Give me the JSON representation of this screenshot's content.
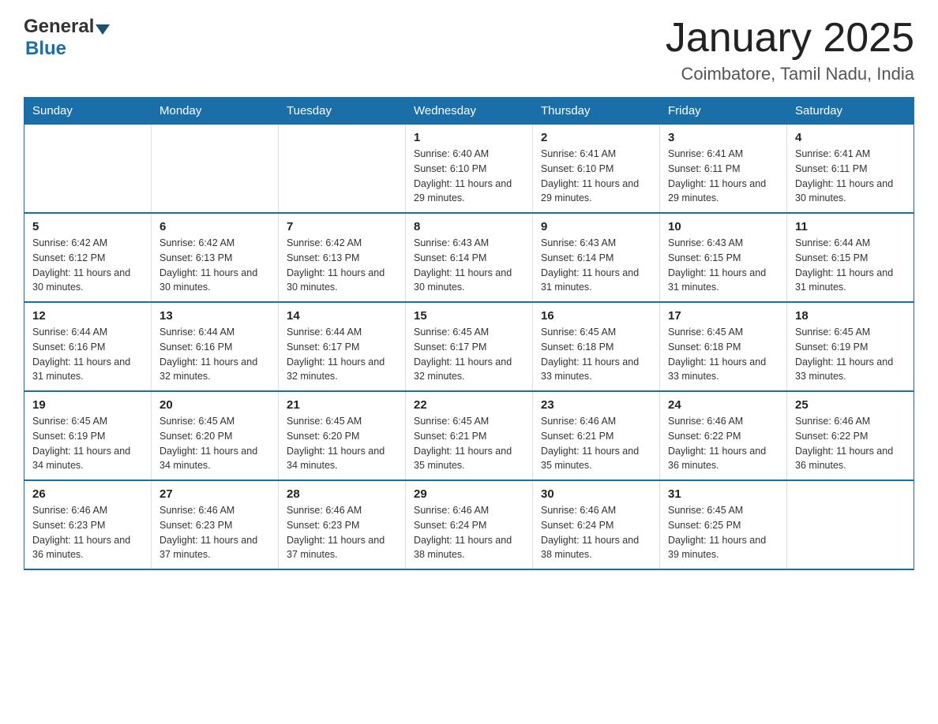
{
  "header": {
    "title": "January 2025",
    "subtitle": "Coimbatore, Tamil Nadu, India",
    "logo_general": "General",
    "logo_blue": "Blue"
  },
  "days_of_week": [
    "Sunday",
    "Monday",
    "Tuesday",
    "Wednesday",
    "Thursday",
    "Friday",
    "Saturday"
  ],
  "weeks": [
    [
      {
        "day": "",
        "info": ""
      },
      {
        "day": "",
        "info": ""
      },
      {
        "day": "",
        "info": ""
      },
      {
        "day": "1",
        "info": "Sunrise: 6:40 AM\nSunset: 6:10 PM\nDaylight: 11 hours and 29 minutes."
      },
      {
        "day": "2",
        "info": "Sunrise: 6:41 AM\nSunset: 6:10 PM\nDaylight: 11 hours and 29 minutes."
      },
      {
        "day": "3",
        "info": "Sunrise: 6:41 AM\nSunset: 6:11 PM\nDaylight: 11 hours and 29 minutes."
      },
      {
        "day": "4",
        "info": "Sunrise: 6:41 AM\nSunset: 6:11 PM\nDaylight: 11 hours and 30 minutes."
      }
    ],
    [
      {
        "day": "5",
        "info": "Sunrise: 6:42 AM\nSunset: 6:12 PM\nDaylight: 11 hours and 30 minutes."
      },
      {
        "day": "6",
        "info": "Sunrise: 6:42 AM\nSunset: 6:13 PM\nDaylight: 11 hours and 30 minutes."
      },
      {
        "day": "7",
        "info": "Sunrise: 6:42 AM\nSunset: 6:13 PM\nDaylight: 11 hours and 30 minutes."
      },
      {
        "day": "8",
        "info": "Sunrise: 6:43 AM\nSunset: 6:14 PM\nDaylight: 11 hours and 30 minutes."
      },
      {
        "day": "9",
        "info": "Sunrise: 6:43 AM\nSunset: 6:14 PM\nDaylight: 11 hours and 31 minutes."
      },
      {
        "day": "10",
        "info": "Sunrise: 6:43 AM\nSunset: 6:15 PM\nDaylight: 11 hours and 31 minutes."
      },
      {
        "day": "11",
        "info": "Sunrise: 6:44 AM\nSunset: 6:15 PM\nDaylight: 11 hours and 31 minutes."
      }
    ],
    [
      {
        "day": "12",
        "info": "Sunrise: 6:44 AM\nSunset: 6:16 PM\nDaylight: 11 hours and 31 minutes."
      },
      {
        "day": "13",
        "info": "Sunrise: 6:44 AM\nSunset: 6:16 PM\nDaylight: 11 hours and 32 minutes."
      },
      {
        "day": "14",
        "info": "Sunrise: 6:44 AM\nSunset: 6:17 PM\nDaylight: 11 hours and 32 minutes."
      },
      {
        "day": "15",
        "info": "Sunrise: 6:45 AM\nSunset: 6:17 PM\nDaylight: 11 hours and 32 minutes."
      },
      {
        "day": "16",
        "info": "Sunrise: 6:45 AM\nSunset: 6:18 PM\nDaylight: 11 hours and 33 minutes."
      },
      {
        "day": "17",
        "info": "Sunrise: 6:45 AM\nSunset: 6:18 PM\nDaylight: 11 hours and 33 minutes."
      },
      {
        "day": "18",
        "info": "Sunrise: 6:45 AM\nSunset: 6:19 PM\nDaylight: 11 hours and 33 minutes."
      }
    ],
    [
      {
        "day": "19",
        "info": "Sunrise: 6:45 AM\nSunset: 6:19 PM\nDaylight: 11 hours and 34 minutes."
      },
      {
        "day": "20",
        "info": "Sunrise: 6:45 AM\nSunset: 6:20 PM\nDaylight: 11 hours and 34 minutes."
      },
      {
        "day": "21",
        "info": "Sunrise: 6:45 AM\nSunset: 6:20 PM\nDaylight: 11 hours and 34 minutes."
      },
      {
        "day": "22",
        "info": "Sunrise: 6:45 AM\nSunset: 6:21 PM\nDaylight: 11 hours and 35 minutes."
      },
      {
        "day": "23",
        "info": "Sunrise: 6:46 AM\nSunset: 6:21 PM\nDaylight: 11 hours and 35 minutes."
      },
      {
        "day": "24",
        "info": "Sunrise: 6:46 AM\nSunset: 6:22 PM\nDaylight: 11 hours and 36 minutes."
      },
      {
        "day": "25",
        "info": "Sunrise: 6:46 AM\nSunset: 6:22 PM\nDaylight: 11 hours and 36 minutes."
      }
    ],
    [
      {
        "day": "26",
        "info": "Sunrise: 6:46 AM\nSunset: 6:23 PM\nDaylight: 11 hours and 36 minutes."
      },
      {
        "day": "27",
        "info": "Sunrise: 6:46 AM\nSunset: 6:23 PM\nDaylight: 11 hours and 37 minutes."
      },
      {
        "day": "28",
        "info": "Sunrise: 6:46 AM\nSunset: 6:23 PM\nDaylight: 11 hours and 37 minutes."
      },
      {
        "day": "29",
        "info": "Sunrise: 6:46 AM\nSunset: 6:24 PM\nDaylight: 11 hours and 38 minutes."
      },
      {
        "day": "30",
        "info": "Sunrise: 6:46 AM\nSunset: 6:24 PM\nDaylight: 11 hours and 38 minutes."
      },
      {
        "day": "31",
        "info": "Sunrise: 6:45 AM\nSunset: 6:25 PM\nDaylight: 11 hours and 39 minutes."
      },
      {
        "day": "",
        "info": ""
      }
    ]
  ]
}
